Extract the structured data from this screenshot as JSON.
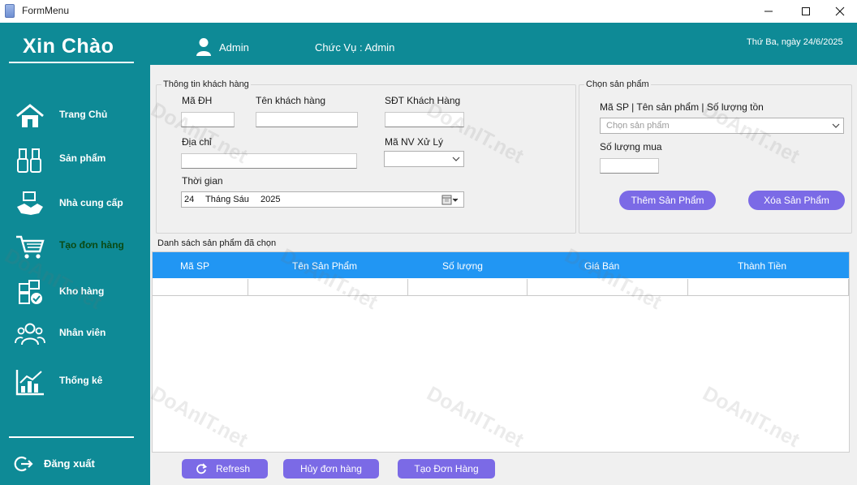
{
  "window": {
    "title": "FormMenu"
  },
  "header": {
    "greeting": "Xin Chào",
    "admin_name": "Admin",
    "role": "Chức Vụ : Admin",
    "date": "Thứ Ba, ngày 24/6/2025"
  },
  "sidebar": {
    "items": [
      {
        "label": "Trang Chủ",
        "icon": "home-icon"
      },
      {
        "label": "Sản phẩm",
        "icon": "usb-icon"
      },
      {
        "label": "Nhà cung cấp",
        "icon": "handshake-icon"
      },
      {
        "label": "Tạo đơn hàng",
        "icon": "cart-icon",
        "active": true
      },
      {
        "label": "Kho hàng",
        "icon": "warehouse-icon"
      },
      {
        "label": "Nhân viên",
        "icon": "people-icon"
      },
      {
        "label": "Thống kê",
        "icon": "chart-icon"
      }
    ],
    "logout_label": "Đăng xuất"
  },
  "customer": {
    "group_title": "Thông tin khách hàng",
    "order_id_label": "Mã ĐH",
    "order_id_value": "",
    "name_label": "Tên khách hàng",
    "name_value": "",
    "phone_label": "SĐT Khách Hàng",
    "phone_value": "",
    "address_label": "Địa chỉ",
    "address_value": "",
    "staff_label": "Mã NV Xử Lý",
    "staff_value": "",
    "time_label": "Thời gian",
    "date_day": "24",
    "date_month": "Tháng Sáu",
    "date_year": "2025"
  },
  "product": {
    "group_title": "Chọn sản phẩm",
    "select_label": "Mã SP | Tên sản phẩm | Số lượng tồn",
    "select_placeholder": "Chọn sản phẩm",
    "qty_label": "Số lượng mua",
    "qty_value": "",
    "add_button": "Thêm Sản Phẩm",
    "remove_button": "Xóa Sản Phẩm"
  },
  "list": {
    "title": "Danh sách sản phẩm đã chọn",
    "columns": [
      "Mã SP",
      "Tên Sản Phẩm",
      "Số lượng",
      "Giá Bán",
      "Thành Tiền"
    ]
  },
  "footer": {
    "refresh": "Refresh",
    "cancel": "Hủy đơn hàng",
    "create": "Tạo Đơn Hàng"
  },
  "watermark": "DoAnIT.net",
  "colors": {
    "teal": "#0e8a96",
    "accent": "#7b6ae6",
    "grid_header": "#2196f3"
  }
}
